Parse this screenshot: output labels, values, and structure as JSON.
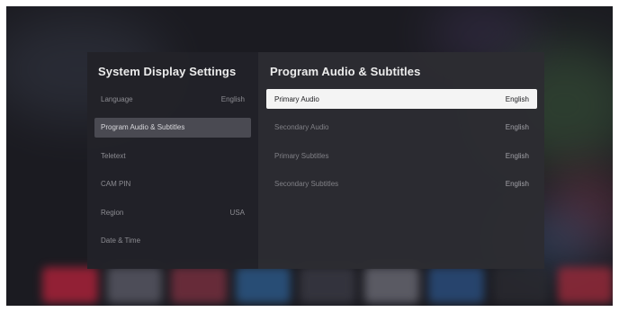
{
  "system_panel": {
    "title": "System Display Settings",
    "items": [
      {
        "label": "Language",
        "value": "English"
      },
      {
        "label": "Program Audio & Subtitles",
        "value": ""
      },
      {
        "label": "Teletext",
        "value": ""
      },
      {
        "label": "CAM PIN",
        "value": ""
      },
      {
        "label": "Region",
        "value": "USA"
      },
      {
        "label": "Date & Time",
        "value": ""
      }
    ]
  },
  "audio_panel": {
    "title": "Program Audio & Subtitles",
    "items": [
      {
        "label": "Primary Audio",
        "value": "English"
      },
      {
        "label": "Secondary Audio",
        "value": "English"
      },
      {
        "label": "Primary Subtitles",
        "value": "English"
      },
      {
        "label": "Secondary Subtitles",
        "value": "English"
      }
    ]
  },
  "colors": {
    "left_panel": "#222228",
    "right_panel": "#2c2c32",
    "selected_item": "#4a4a52",
    "focused_item": "#f4f4f4"
  }
}
